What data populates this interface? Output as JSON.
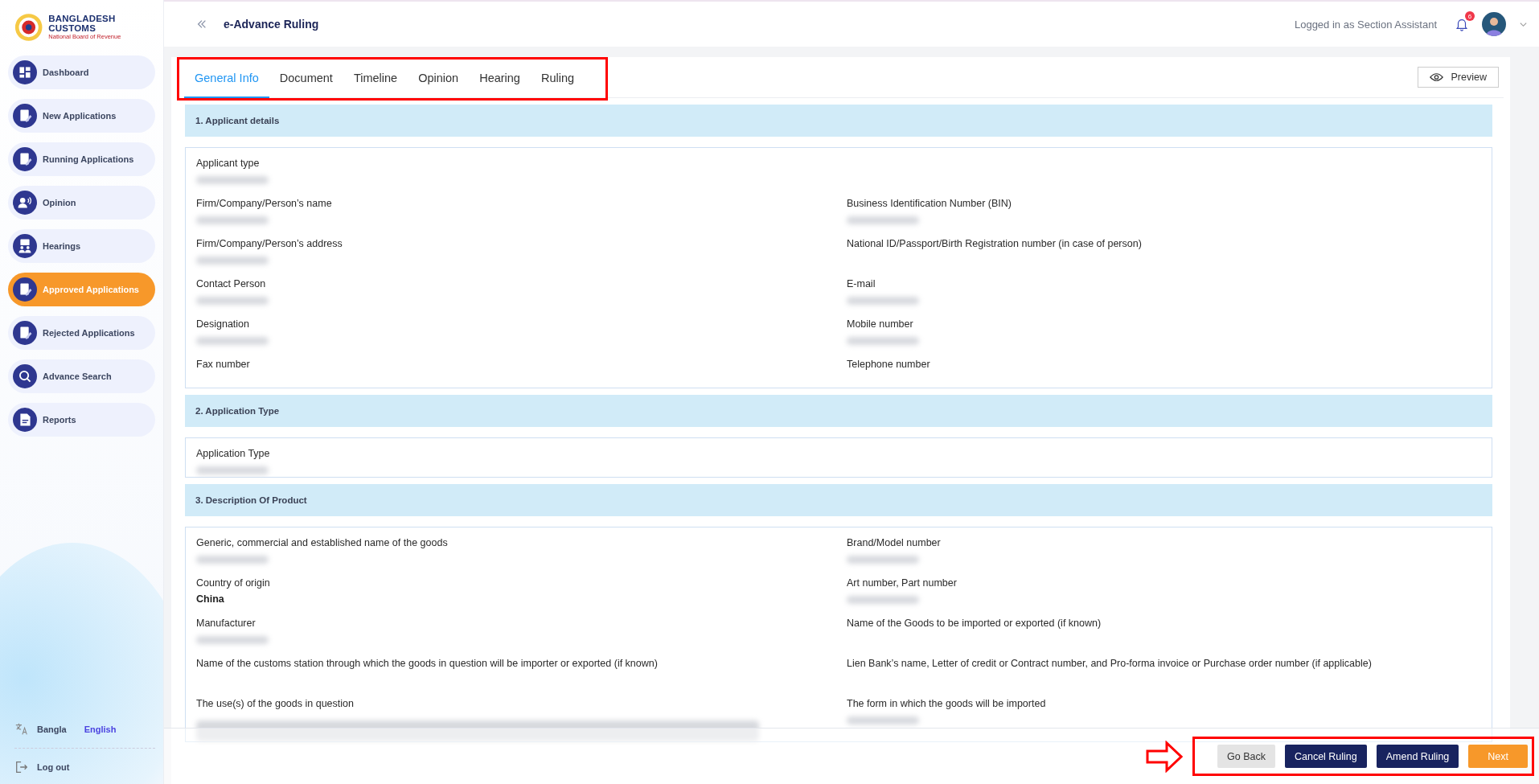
{
  "header": {
    "logo_title": "BANGLADESH CUSTOMS",
    "logo_subtitle": "National Board of Revenue",
    "page_title": "e-Advance Ruling",
    "user_text": "Logged in as Section Assistant",
    "notification_count": "6"
  },
  "sidebar": {
    "items": [
      {
        "label": "Dashboard",
        "selected": false
      },
      {
        "label": "New Applications",
        "selected": false
      },
      {
        "label": "Running Applications",
        "selected": false
      },
      {
        "label": "Opinion",
        "selected": false
      },
      {
        "label": "Hearings",
        "selected": false
      },
      {
        "label": "Approved Applications",
        "selected": true
      },
      {
        "label": "Rejected Applications",
        "selected": false
      },
      {
        "label": "Advance Search",
        "selected": false
      },
      {
        "label": "Reports",
        "selected": false
      }
    ],
    "languages": [
      {
        "label": "Bangla",
        "selected": false
      },
      {
        "label": "English",
        "selected": true
      }
    ],
    "logout": "Log out"
  },
  "tabs": [
    {
      "label": "General Info",
      "selected": true
    },
    {
      "label": "Document",
      "selected": false
    },
    {
      "label": "Timeline",
      "selected": false
    },
    {
      "label": "Opinion",
      "selected": false
    },
    {
      "label": "Hearing",
      "selected": false
    },
    {
      "label": "Ruling",
      "selected": false
    }
  ],
  "preview_button": "Preview",
  "sections": [
    {
      "title": "1. Applicant details",
      "rows": [
        {
          "left": {
            "label": "Applicant type",
            "redacted": true
          }
        },
        {
          "left": {
            "label": "Firm/Company/Person’s name",
            "redacted": true
          },
          "right": {
            "label": "Business Identification Number (BIN)",
            "redacted": true
          }
        },
        {
          "left": {
            "label": "Firm/Company/Person’s address",
            "redacted": true
          },
          "right": {
            "label": "National ID/Passport/Birth Registration number (in case of person)"
          }
        },
        {
          "left": {
            "label": "Contact Person",
            "redacted": true
          },
          "right": {
            "label": "E-mail",
            "redacted": true
          }
        },
        {
          "left": {
            "label": "Designation",
            "redacted": true
          },
          "right": {
            "label": "Mobile number",
            "redacted": true
          }
        },
        {
          "left": {
            "label": "Fax number"
          },
          "right": {
            "label": "Telephone number"
          }
        }
      ]
    },
    {
      "title": "2. Application Type",
      "rows": [
        {
          "left": {
            "label": "Application Type",
            "redacted": true
          }
        }
      ]
    },
    {
      "title": "3. Description Of Product",
      "rows": [
        {
          "left": {
            "label": "Generic, commercial and established name of the goods",
            "redacted": true
          },
          "right": {
            "label": "Brand/Model number",
            "redacted": true
          }
        },
        {
          "left": {
            "label": "Country of origin",
            "value": "China"
          },
          "right": {
            "label": "Art number, Part number",
            "redacted": true
          }
        },
        {
          "left": {
            "label": "Manufacturer",
            "redacted": true
          },
          "right": {
            "label": "Name of the Goods to be imported or exported (if known)"
          }
        },
        {
          "left": {
            "label": "Name of the customs station through which the goods in question will be importer or exported (if known)"
          },
          "right": {
            "label": "Lien Bank’s name, Letter of credit or Contract number, and Pro-forma invoice or Purchase order number (if applicable)"
          }
        },
        {
          "left": {
            "label": "The use(s) of the goods in question",
            "redacted": true,
            "paragraph": true
          },
          "right": {
            "label": "The form in which the goods will be imported",
            "redacted": true
          }
        }
      ]
    }
  ],
  "footer": {
    "buttons": [
      {
        "label": "Go Back",
        "kind": "secondary"
      },
      {
        "label": "Cancel Ruling",
        "kind": "primary"
      },
      {
        "label": "Amend Ruling",
        "kind": "primary"
      },
      {
        "label": "Next",
        "kind": "accent"
      }
    ]
  }
}
